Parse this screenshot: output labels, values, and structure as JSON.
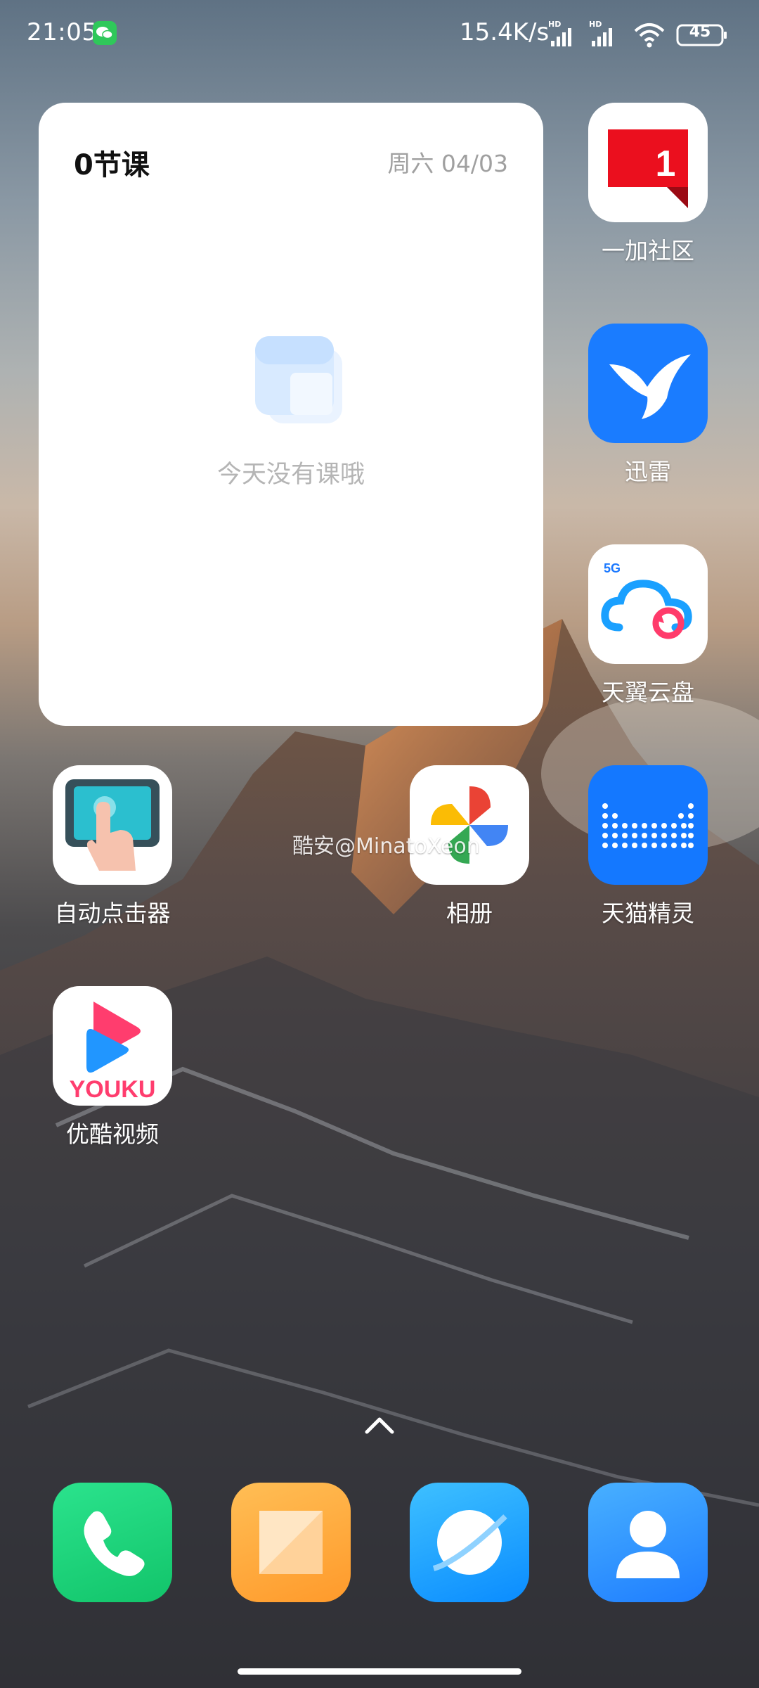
{
  "status_bar": {
    "time": "21:05",
    "network_speed": "15.4K/s",
    "signal_badge_1": "HD",
    "signal_badge_2": "HD",
    "battery": "45"
  },
  "widget": {
    "title": "0节课",
    "date": "周六 04/03",
    "empty_message": "今天没有课哦"
  },
  "apps": {
    "oneplus": {
      "label": "一加社区",
      "badge": "1"
    },
    "xunlei": {
      "label": "迅雷"
    },
    "tianyi": {
      "label": "天翼云盘",
      "badge": "5G"
    },
    "autoclicker": {
      "label": "自动点击器"
    },
    "photos": {
      "label": "相册"
    },
    "tmall_genie": {
      "label": "天猫精灵"
    },
    "youku": {
      "label": "优酷视频",
      "logo_text": "YOUKU"
    }
  },
  "watermark": "酷安@MinatoXeon",
  "dock": [
    "phone-app",
    "notes-app",
    "browser-app",
    "contacts-app"
  ],
  "colors": {
    "phone": "#1fd17a",
    "notes": "#ffa63a",
    "browser": "#1aa3ff",
    "contacts": "#2a8dff",
    "oneplus_red": "#eb0f1e",
    "xunlei_blue": "#1a7cff",
    "tmall_blue": "#1478ff"
  }
}
